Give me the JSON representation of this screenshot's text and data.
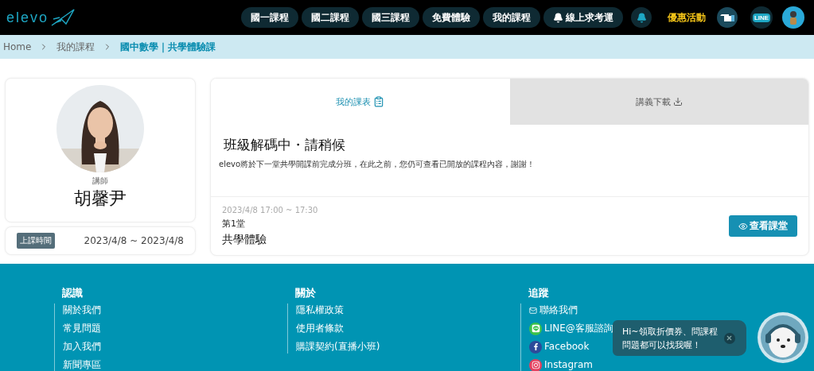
{
  "header": {
    "logo": "elevo",
    "nav": [
      {
        "label": "國一課程",
        "kind": "plain"
      },
      {
        "label": "國二課程",
        "kind": "plain"
      },
      {
        "label": "國三課程",
        "kind": "plain"
      },
      {
        "label": "免費體驗",
        "kind": "plain"
      },
      {
        "label": "我的課程",
        "kind": "plain"
      },
      {
        "label": "線上求考運",
        "kind": "bell"
      }
    ],
    "promo": "優惠活動",
    "line_label": "LINE"
  },
  "breadcrumb": [
    {
      "label": "Home",
      "current": false
    },
    {
      "label": "我的課程",
      "current": false
    },
    {
      "label": "國中數學｜共學體驗課",
      "current": true
    }
  ],
  "teacher": {
    "role": "講師",
    "name": "胡馨尹"
  },
  "schedule": {
    "label": "上課時間",
    "range": "2023/4/8 ~ 2023/4/8"
  },
  "tabs": [
    {
      "label": "我的課表",
      "kind": "schedule",
      "selected": true
    },
    {
      "label": "講義下載",
      "kind": "download",
      "selected": false
    }
  ],
  "notice": {
    "title": "班級解碼中・請稍候",
    "text": "elevo將於下一堂共學開課前完成分班，在此之前，您仍可查看已開放的課程內容，謝謝！"
  },
  "session": {
    "time": "2023/4/8 17:00 ~ 17:30",
    "number": "第1堂",
    "title": "共學體驗",
    "button": "查看課堂"
  },
  "footer": [
    {
      "title": "認識",
      "links": [
        {
          "label": "關於我們",
          "kind": "plain"
        },
        {
          "label": "常見問題",
          "kind": "plain"
        },
        {
          "label": "加入我們",
          "kind": "plain"
        },
        {
          "label": "新聞專區",
          "kind": "plain"
        }
      ]
    },
    {
      "title": "關於",
      "links": [
        {
          "label": "隱私權政策",
          "kind": "plain"
        },
        {
          "label": "使用者條款",
          "kind": "plain"
        },
        {
          "label": "購課契約(直播小班)",
          "kind": "plain"
        }
      ]
    },
    {
      "title": "追蹤",
      "links": [
        {
          "label": "聯絡我們",
          "kind": "mail"
        },
        {
          "label": "LINE@客服諮詢",
          "kind": "line"
        },
        {
          "label": "Facebook",
          "kind": "facebook"
        },
        {
          "label": "Instagram",
          "kind": "instagram"
        }
      ]
    }
  ],
  "chat": {
    "lines": [
      "Hi~領取折價券、問課程",
      "問題都可以找我喔！"
    ]
  }
}
